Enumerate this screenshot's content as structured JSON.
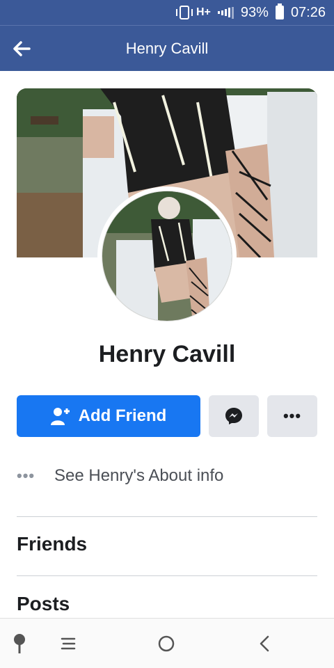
{
  "status_bar": {
    "network": "H+",
    "battery_percent": "93%",
    "time": "07:26"
  },
  "header": {
    "title": "Henry Cavill"
  },
  "profile": {
    "name": "Henry Cavill",
    "add_friend_label": "Add Friend",
    "about_label": "See Henry's About info"
  },
  "sections": {
    "friends": "Friends",
    "posts": "Posts"
  },
  "colors": {
    "brand": "#3b5998",
    "primary_button": "#1877f2",
    "secondary_button": "#e4e6eb"
  },
  "icons": {
    "back": "arrow-left-icon",
    "add_friend": "user-plus-icon",
    "messenger": "messenger-icon",
    "more": "more-horizontal-icon",
    "about": "more-horizontal-icon"
  }
}
